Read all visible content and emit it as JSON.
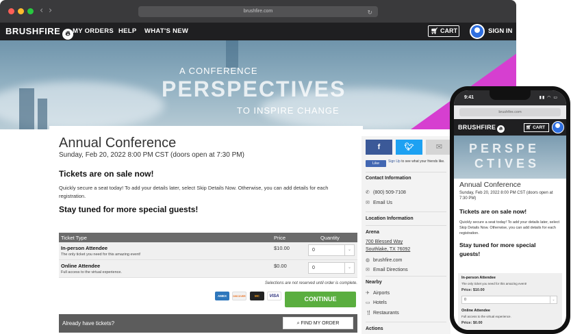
{
  "browser": {
    "url": "brushfire.com",
    "nav": {
      "logo": "BRUSHFIRE",
      "links": [
        "MY ORDERS",
        "HELP",
        "WHAT'S NEW"
      ],
      "cart": "CART",
      "sign_in": "SIGN IN"
    },
    "banner": {
      "line1": "A CONFERENCE",
      "line2": "PERSPECTIVES",
      "line3": "TO INSPIRE CHANGE"
    },
    "event": {
      "title": "Annual Conference",
      "date": "Sunday, Feb 20, 2022 8:00 PM CST (doors open at 7:30 PM)",
      "on_sale_heading": "Tickets are on sale now!",
      "on_sale_text": "Quickly secure a seat today! To add your details later, select Skip Details Now. Otherwise, you can add details for each registration.",
      "stay_tuned": "Stay tuned for more special guests!"
    },
    "tickets": {
      "headers": {
        "type": "Ticket Type",
        "price": "Price",
        "quantity": "Quantity"
      },
      "rows": [
        {
          "name": "In-person Attendee",
          "desc": "The only ticket you need for this amazing event!",
          "price": "$10.00",
          "qty": "0"
        },
        {
          "name": "Online Attendee",
          "desc": "Full access to the virtual experience.",
          "price": "$0.00",
          "qty": "0"
        }
      ],
      "note": "Selections are not reserved until order is complete.",
      "payment_cards": [
        "AMEX",
        "DISCOVER",
        "MC",
        "VISA"
      ],
      "continue": "CONTINUE"
    },
    "already": {
      "label": "Already have tickets?",
      "button": "FIND MY ORDER"
    },
    "sidebar": {
      "fb_like": "Like",
      "fb_signup": "Sign Up",
      "fb_text": "to see what your friends like.",
      "contact_heading": "Contact Information",
      "phone": "(800) 509-7108",
      "email": "Email Us",
      "location_heading": "Location Information",
      "venue": "Arena",
      "address1": "700 Blessed Way",
      "address2": "Southlake, TX 76092",
      "website": "brushfire.com",
      "directions": "Email Directions",
      "nearby_heading": "Nearby",
      "nearby": [
        "Airports",
        "Hotels",
        "Restaurants"
      ],
      "actions_heading": "Actions"
    },
    "colors": {
      "nav_bg": "#1f1f21",
      "continue": "#5aae3f",
      "accent": "#d63fd0",
      "facebook": "#3b5998",
      "twitter": "#1da1f2"
    }
  },
  "phone": {
    "time": "9:41",
    "url": "brushfire.com",
    "logo": "BRUSHFIRE",
    "cart": "CART",
    "banner1": "PERSPE",
    "banner2": "CTIVES",
    "title": "Annual Conference",
    "date": "Sunday, Feb 20, 2022 8:00 PM CST (doors open at 7:30 PM)",
    "on_sale_heading": "Tickets are on sale now!",
    "on_sale_text": "Quickly secure a seat today! To add your details later, select Skip Details Now. Otherwise, you can add details for each registration.",
    "stay_tuned": "Stay tuned for more special guests!",
    "ticket1_name": "In-person Attendee",
    "ticket1_desc": "The only ticket you need for this amazing event!",
    "ticket1_price": "Price: $10.00",
    "ticket1_qty": "0",
    "ticket2_name": "Online Attendee",
    "ticket2_desc": "Full access to the virtual experience.",
    "ticket2_price": "Price: $0.00"
  }
}
